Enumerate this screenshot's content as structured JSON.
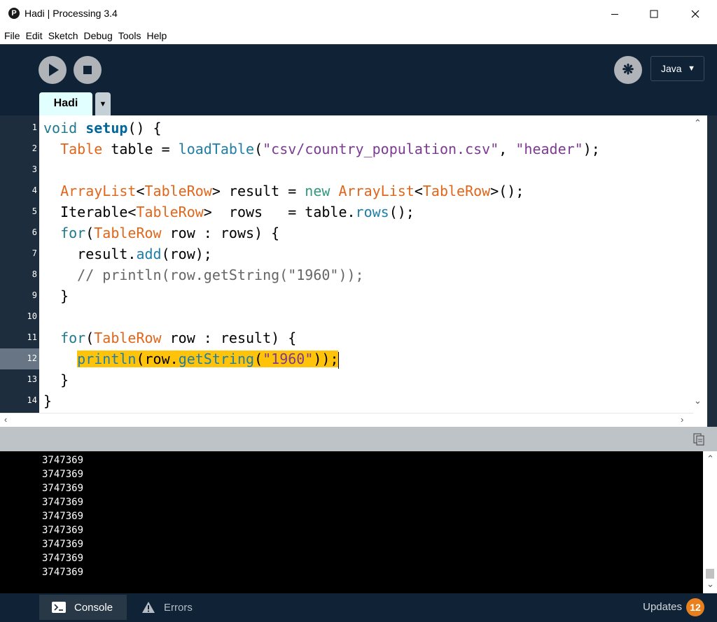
{
  "window": {
    "app_icon": "P",
    "title": "Hadi | Processing 3.4",
    "controls": {
      "minimize": "minimize-icon",
      "maximize": "maximize-icon",
      "close": "close-icon"
    }
  },
  "menu": [
    "File",
    "Edit",
    "Sketch",
    "Debug",
    "Tools",
    "Help"
  ],
  "toolbar": {
    "run": "play-icon",
    "stop": "stop-icon",
    "debugger": "butterfly-debugger-icon",
    "mode": "Java",
    "mode_caret": "▼"
  },
  "tabs": [
    {
      "label": "Hadi"
    }
  ],
  "tab_menu": "▼",
  "editor": {
    "current_line": 12,
    "line_numbers": [
      "1",
      "2",
      "3",
      "4",
      "5",
      "6",
      "7",
      "8",
      "9",
      "10",
      "11",
      "12",
      "13",
      "14"
    ],
    "lines": [
      [
        [
          "kw",
          "void "
        ],
        [
          "fn",
          "setup"
        ],
        [
          "",
          "() {"
        ]
      ],
      [
        [
          "",
          "  "
        ],
        [
          "tp",
          "Table"
        ],
        [
          "",
          " table = "
        ],
        [
          "mt",
          "loadTable"
        ],
        [
          "",
          "("
        ],
        [
          "st",
          "\"csv/country_population.csv\""
        ],
        [
          "",
          ", "
        ],
        [
          "st",
          "\"header\""
        ],
        [
          "",
          ");"
        ]
      ],
      [],
      [
        [
          "",
          "  "
        ],
        [
          "tp",
          "ArrayList"
        ],
        [
          "",
          "<"
        ],
        [
          "tp",
          "TableRow"
        ],
        [
          "",
          "> result = "
        ],
        [
          "nw",
          "new "
        ],
        [
          "tp",
          "ArrayList"
        ],
        [
          "",
          "<"
        ],
        [
          "tp",
          "TableRow"
        ],
        [
          "",
          ">();"
        ]
      ],
      [
        [
          "",
          "  Iterable<"
        ],
        [
          "tp",
          "TableRow"
        ],
        [
          "",
          ">  rows   = table."
        ],
        [
          "mt",
          "rows"
        ],
        [
          "",
          "();"
        ]
      ],
      [
        [
          "",
          "  "
        ],
        [
          "kw",
          "for"
        ],
        [
          "",
          "("
        ],
        [
          "tp",
          "TableRow"
        ],
        [
          "",
          " row : rows) {"
        ]
      ],
      [
        [
          "",
          "    result."
        ],
        [
          "mt",
          "add"
        ],
        [
          "",
          "(row);"
        ]
      ],
      [
        [
          "",
          "    "
        ],
        [
          "cm",
          "// println(row.getString(\"1960\"));"
        ]
      ],
      [
        [
          "",
          "  }"
        ]
      ],
      [],
      [
        [
          "",
          "  "
        ],
        [
          "kw",
          "for"
        ],
        [
          "",
          "("
        ],
        [
          "tp",
          "TableRow"
        ],
        [
          "",
          " row : result) {"
        ]
      ],
      [
        [
          "",
          "    "
        ],
        [
          "hl mt",
          "println"
        ],
        [
          "hl",
          "(row."
        ],
        [
          "hl mt",
          "getString"
        ],
        [
          "hl",
          "("
        ],
        [
          "hl st",
          "\"1960\""
        ],
        [
          "hl",
          "));"
        ]
      ],
      [
        [
          "",
          "  }"
        ]
      ],
      [
        [
          "",
          "}"
        ]
      ]
    ]
  },
  "console": {
    "copy_icon": "copy-console-icon",
    "lines": [
      "3747369",
      "3747369",
      "3747369",
      "3747369",
      "3747369",
      "3747369",
      "3747369",
      "3747369",
      "3747369"
    ]
  },
  "status": {
    "console_tab": "Console",
    "errors_tab": "Errors",
    "updates_label": "Updates",
    "updates_count": "12"
  }
}
